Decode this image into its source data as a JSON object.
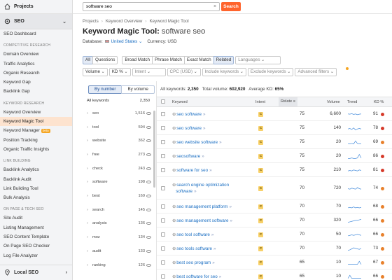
{
  "sidebar": {
    "projects_label": "Projects",
    "seo_label": "SEO",
    "local_seo_label": "Local SEO",
    "new_badge": "beta",
    "groups": [
      {
        "items": [
          {
            "label": "SEO Dashboard"
          }
        ]
      },
      {
        "section": "COMPETITIVE RESEARCH",
        "items": [
          {
            "label": "Domain Overview"
          },
          {
            "label": "Traffic Analytics"
          },
          {
            "label": "Organic Research"
          },
          {
            "label": "Keyword Gap"
          },
          {
            "label": "Backlink Gap"
          }
        ]
      },
      {
        "section": "KEYWORD RESEARCH",
        "items": [
          {
            "label": "Keyword Overview"
          },
          {
            "label": "Keyword Magic Tool",
            "active": true
          },
          {
            "label": "Keyword Manager",
            "badge": true
          },
          {
            "label": "Position Tracking"
          },
          {
            "label": "Organic Traffic Insights"
          }
        ]
      },
      {
        "section": "LINK BUILDING",
        "items": [
          {
            "label": "Backlink Analytics"
          },
          {
            "label": "Backlink Audit"
          },
          {
            "label": "Link Building Tool"
          },
          {
            "label": "Bulk Analysis"
          }
        ]
      },
      {
        "section": "ON PAGE & TECH SEO",
        "items": [
          {
            "label": "Site Audit"
          },
          {
            "label": "Listing Management"
          },
          {
            "label": "SEO Content Template"
          },
          {
            "label": "On Page SEO Checker"
          },
          {
            "label": "Log File Analyzer"
          }
        ]
      }
    ]
  },
  "top_search": {
    "value": "software seo",
    "button_label": "Search"
  },
  "breadcrumb": [
    "Projects",
    "Keyword Overview",
    "Keyword Magic Tool"
  ],
  "title": {
    "prefix": "Keyword Magic Tool:",
    "keyword": "software seo"
  },
  "database": {
    "label": "Database:",
    "value": "United States",
    "currency": "Currency: USD"
  },
  "filters": {
    "match_tabs": [
      "All",
      "Questions"
    ],
    "match_types": [
      "Broad Match",
      "Phrase Match",
      "Exact Match",
      "Related"
    ],
    "languages": "Languages",
    "row2": [
      "Volume",
      "KD %",
      "Intent",
      "CPC (USD)",
      "Include keywords",
      "Exclude keywords",
      "Advanced filters"
    ]
  },
  "groups_panel": {
    "toggle": [
      "By number",
      "By volume"
    ],
    "header_label": "All keywords",
    "header_count": "2,350",
    "rows": [
      {
        "word": "seo",
        "count": "1,516"
      },
      {
        "word": "tool",
        "count": "594"
      },
      {
        "word": "website",
        "count": "362"
      },
      {
        "word": "free",
        "count": "273"
      },
      {
        "word": "check",
        "count": "243"
      },
      {
        "word": "software",
        "count": "198"
      },
      {
        "word": "best",
        "count": "169"
      },
      {
        "word": "search",
        "count": "145"
      },
      {
        "word": "analysis",
        "count": "136"
      },
      {
        "word": "moz",
        "count": "134"
      },
      {
        "word": "audit",
        "count": "133"
      },
      {
        "word": "ranking",
        "count": "126"
      }
    ]
  },
  "summary": {
    "all_keywords_label": "All keywords:",
    "all_keywords": "2,350",
    "total_volume_label": "Total volume:",
    "total_volume": "602,920",
    "avg_kd_label": "Average KD:",
    "avg_kd": "65%"
  },
  "table": {
    "headers": {
      "keyword": "Keyword",
      "intent": "Intent",
      "related": "Relate",
      "volume": "Volume",
      "trend": "Trend",
      "kd": "KD %"
    },
    "rows": [
      {
        "keyword": [
          "seo software"
        ],
        "intent": "C",
        "related": "75",
        "volume": "6,600",
        "kd": "91",
        "kd_color": "#d63b2b",
        "trend": [
          0.6,
          0.55,
          0.65,
          0.5,
          0.6,
          0.45,
          0.55,
          0.6
        ]
      },
      {
        "keyword": [
          "seo software"
        ],
        "intent": "C",
        "related": "75",
        "volume": "140",
        "kd": "78",
        "kd_color": "#d63b2b",
        "trend": [
          0.4,
          0.5,
          0.3,
          0.6,
          0.2,
          0.4,
          0.5,
          0.4
        ]
      },
      {
        "keyword": [
          "seo website software"
        ],
        "intent": "C",
        "related": "75",
        "volume": "20",
        "kd": "69",
        "kd_color": "#e8812c",
        "trend": [
          0.2,
          0.2,
          0.3,
          0.2,
          0.8,
          0.3,
          0.2,
          0.2
        ]
      },
      {
        "keyword": [
          "seosoftware"
        ],
        "intent": "C",
        "related": "75",
        "volume": "20",
        "kd": "86",
        "kd_color": "#d63b2b",
        "trend": [
          0.1,
          0.1,
          0.2,
          0.1,
          0.1,
          0.2,
          0.9,
          0.2
        ]
      },
      {
        "keyword": [
          "software for seo"
        ],
        "intent": "C",
        "related": "75",
        "volume": "210",
        "kd": "81",
        "kd_color": "#d63b2b",
        "trend": [
          0.4,
          0.5,
          0.4,
          0.6,
          0.5,
          0.4,
          0.6,
          0.5
        ]
      },
      {
        "keyword": [
          "search engine optimization",
          "software"
        ],
        "intent": "C",
        "related": "70",
        "volume": "720",
        "kd": "74",
        "kd_color": "#e8812c",
        "trend": [
          0.5,
          0.4,
          0.6,
          0.5,
          0.4,
          0.7,
          0.5,
          0.4
        ]
      },
      {
        "keyword": [
          "seo management platform"
        ],
        "intent": "C",
        "related": "70",
        "volume": "70",
        "kd": "68",
        "kd_color": "#e8812c",
        "trend": [
          0.3,
          0.4,
          0.3,
          0.5,
          0.3,
          0.4,
          0.3,
          0.4
        ]
      },
      {
        "keyword": [
          "seo management software"
        ],
        "intent": "C",
        "related": "70",
        "volume": "320",
        "kd": "66",
        "kd_color": "#e8812c",
        "trend": [
          0.2,
          0.3,
          0.4,
          0.5,
          0.6,
          0.6,
          0.7,
          0.8
        ]
      },
      {
        "keyword": [
          "seo tool software"
        ],
        "intent": "C",
        "related": "70",
        "volume": "50",
        "kd": "66",
        "kd_color": "#e8812c",
        "trend": [
          0.3,
          0.4,
          0.5,
          0.4,
          0.5,
          0.6,
          0.5,
          0.4
        ]
      },
      {
        "keyword": [
          "seo tools software"
        ],
        "intent": "C",
        "related": "70",
        "volume": "70",
        "kd": "73",
        "kd_color": "#e8812c",
        "trend": [
          0.2,
          0.3,
          0.5,
          0.7,
          0.6,
          0.5,
          0.4,
          0.6
        ]
      },
      {
        "keyword": [
          "best seo program"
        ],
        "intent": "C",
        "related": "65",
        "volume": "10",
        "kd": "67",
        "kd_color": "#e8812c",
        "trend": [
          0.2,
          0.2,
          0.2,
          0.2,
          0.2,
          0.2,
          0.8,
          0.2
        ]
      },
      {
        "keyword": [
          "best software for seo"
        ],
        "intent": "C",
        "related": "65",
        "volume": "10",
        "kd": "66",
        "kd_color": "#e8812c",
        "trend": [
          0.2,
          0.8,
          0.2,
          0.2,
          0.2,
          0.2,
          0.2,
          0.2
        ]
      }
    ]
  }
}
